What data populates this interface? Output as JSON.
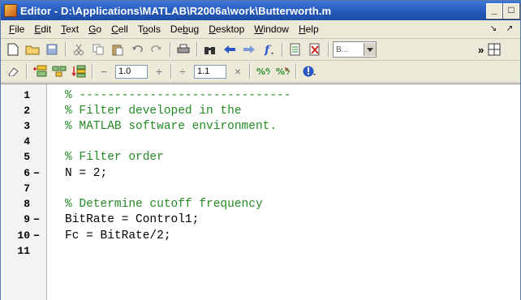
{
  "window": {
    "title": "Editor - D:\\Applications\\MATLAB\\R2006a\\work\\Butterworth.m",
    "minimize_label": "_",
    "maximize_label": "□"
  },
  "menu": {
    "items": [
      {
        "u": "F",
        "rest": "ile"
      },
      {
        "u": "E",
        "rest": "dit"
      },
      {
        "u": "T",
        "rest": "ext"
      },
      {
        "u": "G",
        "rest": "o"
      },
      {
        "u": "C",
        "rest": "ell"
      },
      {
        "pre": "T",
        "u": "o",
        "rest": "ols"
      },
      {
        "pre": "De",
        "u": "b",
        "rest": "ug"
      },
      {
        "u": "D",
        "rest": "esktop"
      },
      {
        "u": "W",
        "rest": "indow"
      },
      {
        "u": "H",
        "rest": "elp"
      }
    ],
    "dock_glyphs": [
      "↘",
      "↗"
    ]
  },
  "toolbar": {
    "stack_combo_value": "B...",
    "overflow_label": "»"
  },
  "cell_toolbar": {
    "minus_label": "−",
    "plus_label": "+",
    "divide_label": "÷",
    "times_label": "×",
    "value1": "1.0",
    "value2": "1.1"
  },
  "editor": {
    "lines": [
      {
        "num": "1",
        "mark": "",
        "type": "comment",
        "text": "% ------------------------------"
      },
      {
        "num": "2",
        "mark": "",
        "type": "comment",
        "text": "% Filter developed in the"
      },
      {
        "num": "3",
        "mark": "",
        "type": "comment",
        "text": "% MATLAB software environment."
      },
      {
        "num": "4",
        "mark": "",
        "type": "plain",
        "text": ""
      },
      {
        "num": "5",
        "mark": "",
        "type": "comment",
        "text": "% Filter order"
      },
      {
        "num": "6",
        "mark": "–",
        "type": "plain",
        "text": "N = 2;"
      },
      {
        "num": "7",
        "mark": "",
        "type": "plain",
        "text": ""
      },
      {
        "num": "8",
        "mark": "",
        "type": "comment",
        "text": "% Determine cutoff frequency"
      },
      {
        "num": "9",
        "mark": "–",
        "type": "plain",
        "text": "BitRate = Control1;"
      },
      {
        "num": "10",
        "mark": "–",
        "type": "plain",
        "text": "Fc = BitRate/2;"
      },
      {
        "num": "11",
        "mark": "",
        "type": "plain",
        "text": ""
      }
    ]
  }
}
